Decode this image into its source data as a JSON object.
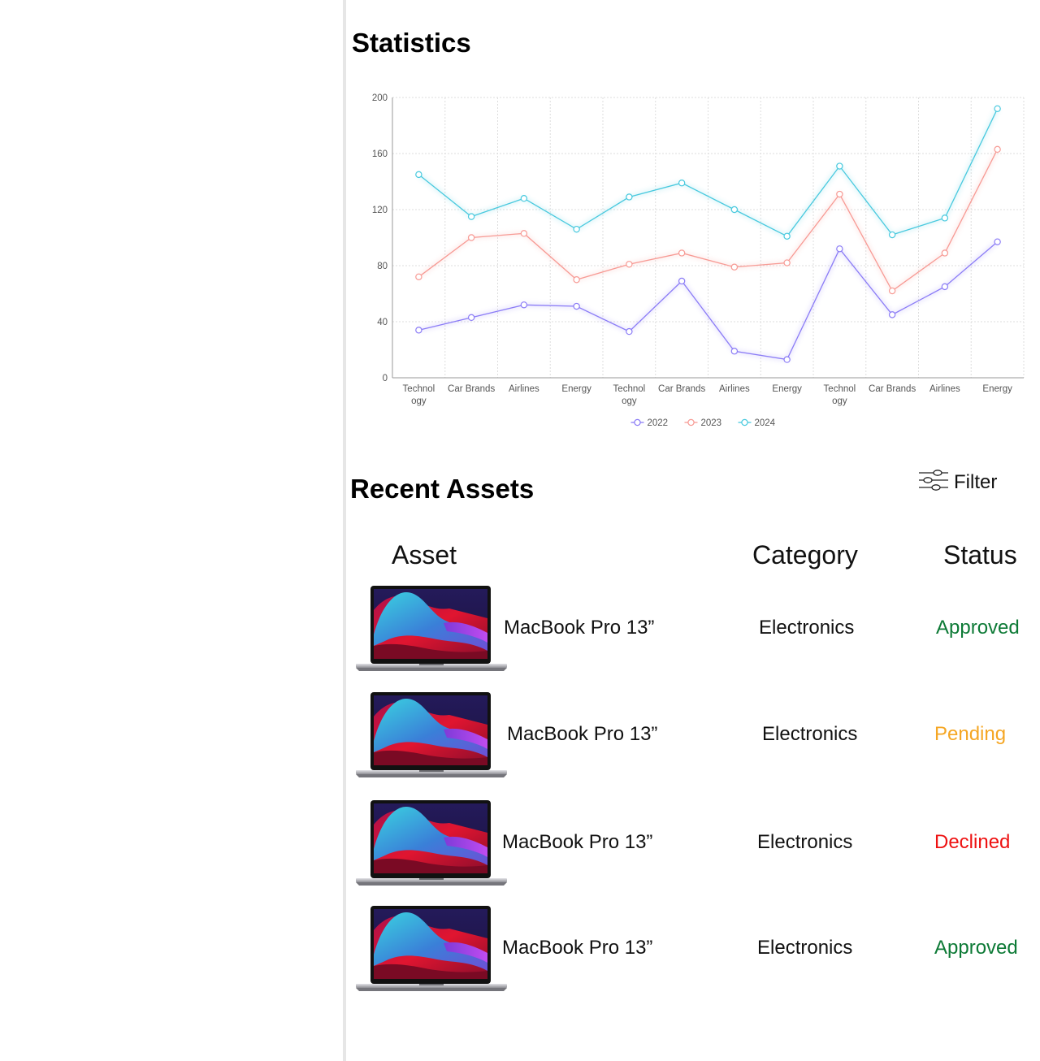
{
  "statistics": {
    "title": "Statistics"
  },
  "chart_data": {
    "type": "line",
    "categories": [
      "Technology",
      "Car Brands",
      "Airlines",
      "Energy",
      "Technology",
      "Car Brands",
      "Airlines",
      "Energy",
      "Technology",
      "Car Brands",
      "Airlines",
      "Energy"
    ],
    "tick_labels": [
      [
        "Technol",
        "ogy"
      ],
      [
        "Car Brands"
      ],
      [
        "Airlines"
      ],
      [
        "Energy"
      ],
      [
        "Technol",
        "ogy"
      ],
      [
        "Car Brands"
      ],
      [
        "Airlines"
      ],
      [
        "Energy"
      ],
      [
        "Technol",
        "ogy"
      ],
      [
        "Car Brands"
      ],
      [
        "Airlines"
      ],
      [
        "Energy"
      ]
    ],
    "series": [
      {
        "name": "2022",
        "color": "#8b7cf6",
        "values": [
          34,
          43,
          52,
          51,
          33,
          69,
          19,
          13,
          92,
          45,
          65,
          97
        ]
      },
      {
        "name": "2023",
        "color": "#f79a94",
        "values": [
          72,
          100,
          103,
          70,
          81,
          89,
          79,
          82,
          131,
          62,
          89,
          163
        ]
      },
      {
        "name": "2024",
        "color": "#48c9de",
        "values": [
          145,
          115,
          128,
          106,
          129,
          139,
          120,
          101,
          151,
          102,
          114,
          192
        ]
      }
    ],
    "ylim": [
      0,
      200
    ],
    "yticks": [
      0,
      40,
      80,
      120,
      160,
      200
    ],
    "grid": true,
    "legend": "bottom-center",
    "title": "",
    "xlabel": "",
    "ylabel": ""
  },
  "assets": {
    "title": "Recent Assets",
    "filter_label": "Filter",
    "columns": {
      "asset": "Asset",
      "category": "Category",
      "status": "Status"
    },
    "rows": [
      {
        "name": "MacBook Pro 13”",
        "category": "Electronics",
        "status": "Approved",
        "status_color": "#0d7a36"
      },
      {
        "name": "MacBook Pro 13”",
        "category": "Electronics",
        "status": "Pending",
        "status_color": "#f5a623"
      },
      {
        "name": "MacBook Pro 13”",
        "category": "Electronics",
        "status": "Declined",
        "status_color": "#ee1111"
      },
      {
        "name": "MacBook Pro 13”",
        "category": "Electronics",
        "status": "Approved",
        "status_color": "#0d7a36"
      }
    ]
  }
}
